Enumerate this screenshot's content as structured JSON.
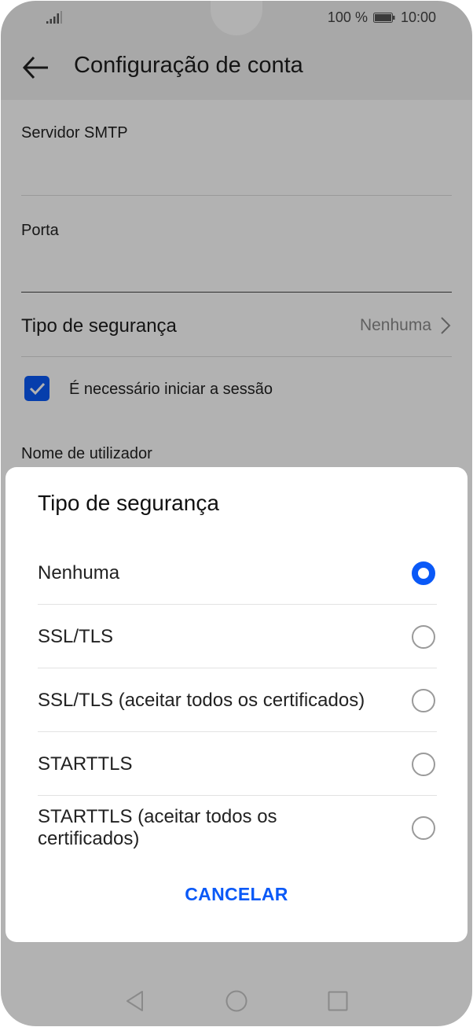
{
  "status_bar": {
    "battery_text": "100 %",
    "time": "10:00",
    "icons": [
      "signal-icon",
      "battery-icon"
    ]
  },
  "header": {
    "title": "Configuração de conta",
    "back_icon": "arrow-left-icon"
  },
  "settings": {
    "smtp_server_label": "Servidor SMTP",
    "port_label": "Porta",
    "security_type_label": "Tipo de segurança",
    "security_type_value": "Nenhuma",
    "login_required_label": "É necessário iniciar a sessão",
    "login_required_checked": true,
    "username_label": "Nome de utilizador"
  },
  "dialog": {
    "title": "Tipo de segurança",
    "options": [
      {
        "label": "Nenhuma",
        "selected": true
      },
      {
        "label": "SSL/TLS",
        "selected": false
      },
      {
        "label": "SSL/TLS (aceitar todos os certificados)",
        "selected": false
      },
      {
        "label": "STARTTLS",
        "selected": false
      },
      {
        "label": "STARTTLS (aceitar todos os certificados)",
        "selected": false
      }
    ],
    "cancel_label": "CANCELAR"
  },
  "nav_bar": {
    "icons": [
      "back-triangle-icon",
      "home-circle-icon",
      "recents-square-icon"
    ]
  },
  "colors": {
    "accent": "#0a59f7",
    "scrim": "rgba(0,0,0,0.30)"
  }
}
